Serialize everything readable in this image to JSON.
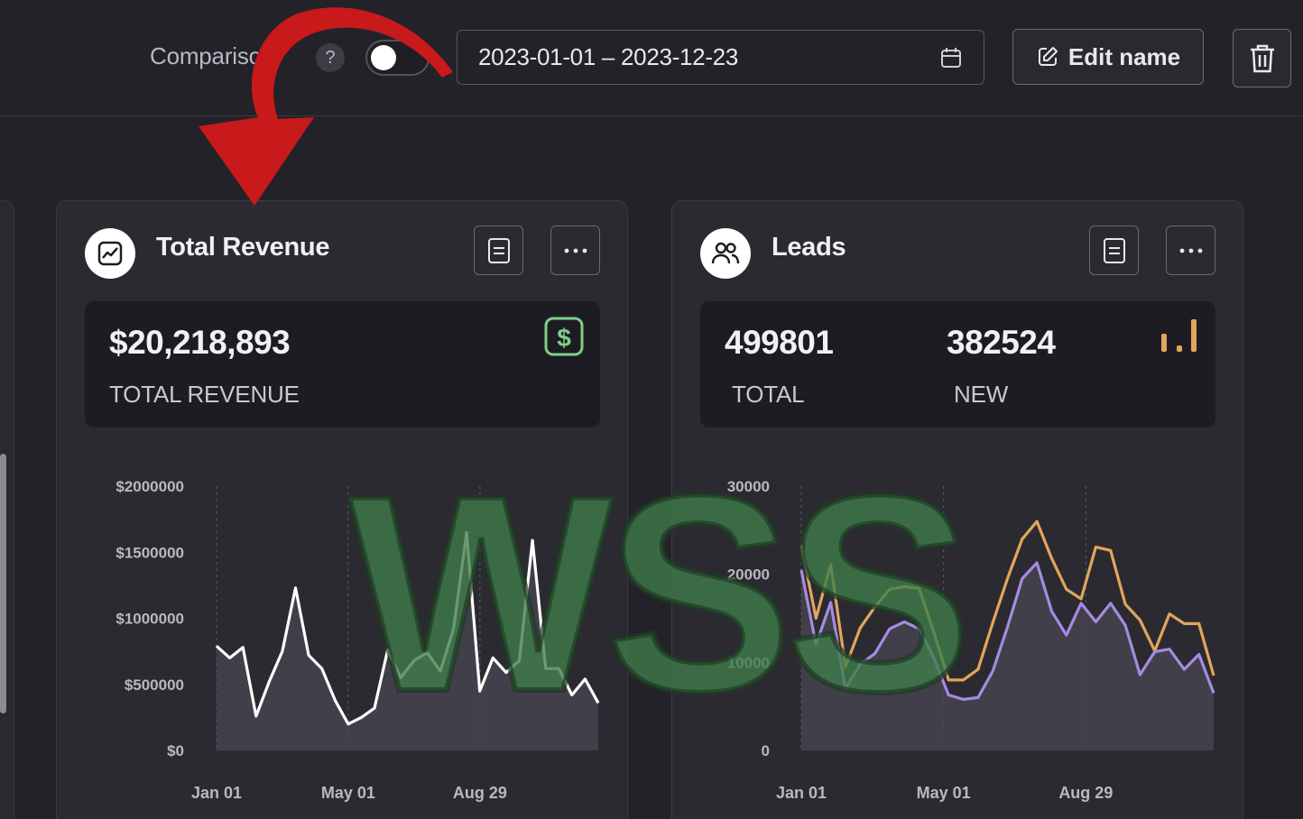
{
  "topbar": {
    "compare_label": "Comparison",
    "help_label": "?",
    "date_range": "2023-01-01 – 2023-12-23",
    "edit_label": "Edit name"
  },
  "cards": [
    {
      "title": "Total Revenue",
      "stat_value": "$20,218,893",
      "stat_label": "TOTAL REVENUE",
      "stat_icon": "dollar-icon",
      "stat_icon_color": "#7fcf8a"
    },
    {
      "title": "Leads",
      "total_value": "499801",
      "total_label": "TOTAL",
      "new_value": "382524",
      "new_label": "NEW",
      "stat_icon": "bar-chart-icon",
      "stat_icon_color": "#e3a55c"
    }
  ],
  "watermark_text": "WSS",
  "chart_data": [
    {
      "type": "area",
      "y_ticks": [
        "$2000000",
        "$1500000",
        "$1000000",
        "$500000",
        "$0"
      ],
      "x_ticks": [
        "Jan 01",
        "May 01",
        "Aug 29"
      ],
      "ylim": [
        0,
        2000000
      ],
      "grid": "vertical dashed",
      "series": [
        {
          "color": "#ffffff",
          "values": [
            790000,
            700000,
            780000,
            260000,
            520000,
            750000,
            1230000,
            720000,
            620000,
            380000,
            200000,
            250000,
            320000,
            760000,
            550000,
            680000,
            740000,
            600000,
            920000,
            1650000,
            450000,
            700000,
            590000,
            680000,
            1590000,
            620000,
            620000,
            420000,
            540000,
            360000
          ]
        }
      ]
    },
    {
      "type": "area",
      "y_ticks": [
        "30000",
        "20000",
        "10000",
        "0"
      ],
      "x_ticks": [
        "Jan 01",
        "May 01",
        "Aug 29"
      ],
      "ylim": [
        0,
        30000
      ],
      "grid": "vertical dashed",
      "series": [
        {
          "color": "#e3a55c",
          "values": [
            23300,
            15000,
            21100,
            9500,
            13900,
            16300,
            18300,
            18600,
            18400,
            13400,
            8000,
            8000,
            9200,
            14500,
            19500,
            24000,
            26000,
            21800,
            18300,
            17200,
            23100,
            22700,
            16600,
            14800,
            11300,
            15500,
            14400,
            14400,
            8500
          ]
        },
        {
          "color": "#a58be0",
          "values": [
            20500,
            12000,
            16800,
            7000,
            9800,
            11000,
            13800,
            14600,
            13800,
            10500,
            6300,
            5800,
            6000,
            9000,
            14000,
            19500,
            21300,
            15800,
            13100,
            16700,
            14600,
            16700,
            14200,
            8600,
            11200,
            11500,
            9200,
            10900,
            6500
          ]
        }
      ]
    }
  ]
}
